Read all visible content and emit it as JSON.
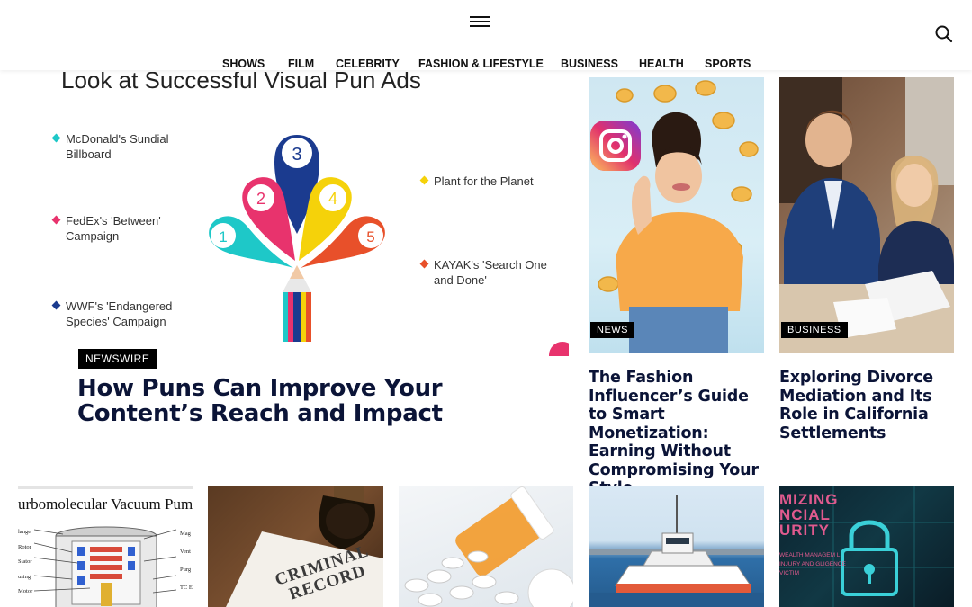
{
  "header": {
    "nav": [
      "SHOWS",
      "FILM",
      "CELEBRITY",
      "FASHION & LIFESTYLE",
      "BUSINESS",
      "HEALTH",
      "SPORTS"
    ]
  },
  "hero": {
    "image_heading": "Look at Successful Visual Pun Ads",
    "image_items": [
      "McDonald's Sundial Billboard",
      "FedEx's 'Between' Campaign",
      "WWF's 'Endangered Species' Campaign",
      "Plant for the Planet",
      "KAYAK's 'Search One and Done'"
    ],
    "image_numbers": [
      "1",
      "2",
      "3",
      "4",
      "5"
    ],
    "badge": "NEWSWIRE",
    "headline": "How Puns Can Improve Your Content’s Reach and Impact"
  },
  "cards": [
    {
      "badge": "NEWS",
      "title": "The Fashion Influencer’s Guide to Smart Monetization: Earning Without Compromising Your Style"
    },
    {
      "badge": "BUSINESS",
      "title": "Exploring Divorce Mediation and Its Role in California Settlements"
    }
  ],
  "thumbs": {
    "vacuum_title": "urbomolecular Vacuum Pum",
    "vacuum_labels_left": [
      "lange",
      "Rotor",
      "Stator",
      "using",
      "Motor"
    ],
    "vacuum_labels_right": [
      "Mag",
      "Vent",
      "Purg",
      "TC E"
    ],
    "criminal_text": "CRIMINAL RECORD",
    "security_text": "MIZING NCIAL URITY",
    "security_sub": "WEALTH MANAGEM L INJURY AND GLIGENCE VICTIM"
  },
  "colors": {
    "headline": "#0b1437",
    "badge_bg": "#000000",
    "petal_1": "#1ec8c8",
    "petal_2": "#e8336d",
    "petal_3": "#1b3b8f",
    "petal_4": "#f5d20a",
    "petal_5": "#e8502a"
  }
}
